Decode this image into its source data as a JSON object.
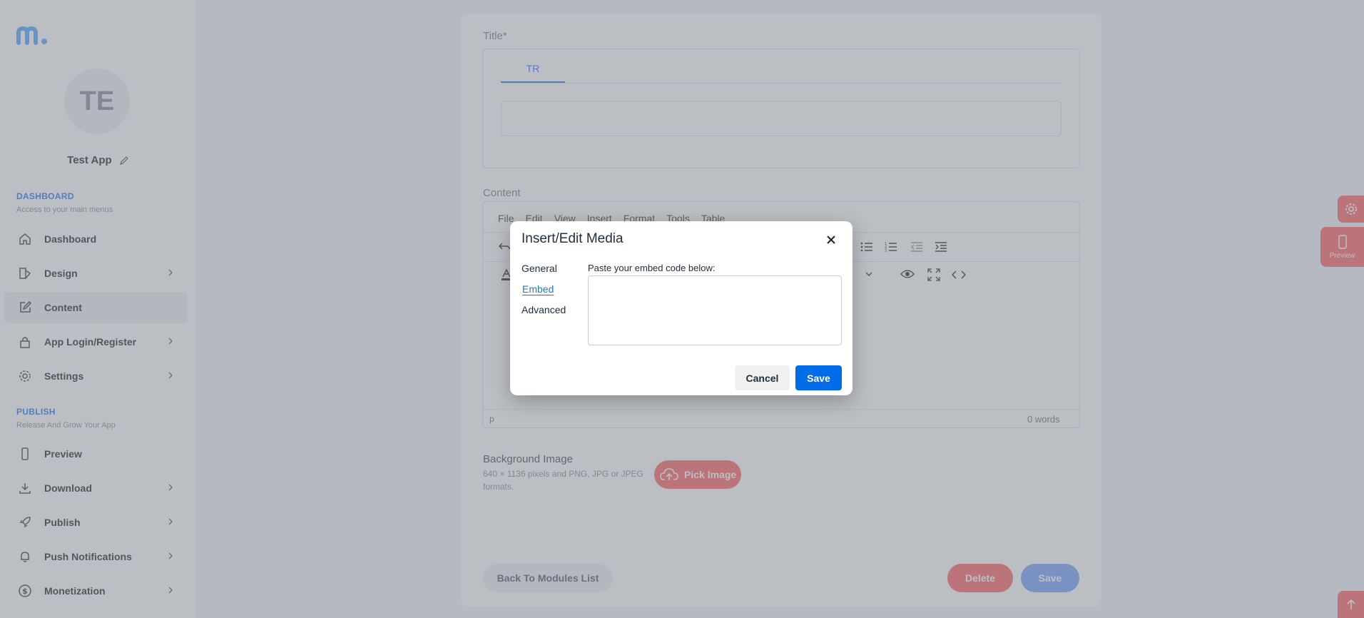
{
  "sidebar": {
    "avatar_initials": "TE",
    "app_name": "Test App",
    "sections": [
      {
        "title": "DASHBOARD",
        "subtitle": "Access to your main menus"
      },
      {
        "title": "PUBLISH",
        "subtitle": "Release And Grow Your App"
      }
    ],
    "items": [
      {
        "label": "Dashboard",
        "icon": "home-icon"
      },
      {
        "label": "Design",
        "icon": "design-icon"
      },
      {
        "label": "Content",
        "icon": "edit-icon"
      },
      {
        "label": "App Login/Register",
        "icon": "lock-icon"
      },
      {
        "label": "Settings",
        "icon": "gear-icon"
      },
      {
        "label": "Preview",
        "icon": "phone-icon"
      },
      {
        "label": "Download",
        "icon": "download-icon"
      },
      {
        "label": "Publish",
        "icon": "rocket-icon"
      },
      {
        "label": "Push Notifications",
        "icon": "bell-icon"
      },
      {
        "label": "Monetization",
        "icon": "dollar-icon"
      }
    ]
  },
  "form": {
    "title_label": "Title*",
    "lang_tab": "TR",
    "content_label": "Content",
    "menubar": [
      "File",
      "Edit",
      "View",
      "Insert",
      "Format",
      "Tools",
      "Table"
    ],
    "status_path": "p",
    "word_count": "0 words",
    "bg_label": "Background Image",
    "bg_hint": "640 × 1136 pixels and PNG, JPG or JPEG formats.",
    "pick_image": "Pick Image",
    "back_button": "Back To Modules List",
    "delete_button": "Delete",
    "save_button": "Save"
  },
  "floating": {
    "preview_label": "Preview"
  },
  "dialog": {
    "title": "Insert/Edit Media",
    "tabs": [
      "General",
      "Embed",
      "Advanced"
    ],
    "active_tab": "Embed",
    "hint": "Paste your embed code below:",
    "embed_value": "",
    "cancel": "Cancel",
    "save": "Save"
  },
  "colors": {
    "accent": "#2f7df6",
    "danger": "#ff6b6b",
    "dialog_primary": "#006ce7"
  }
}
